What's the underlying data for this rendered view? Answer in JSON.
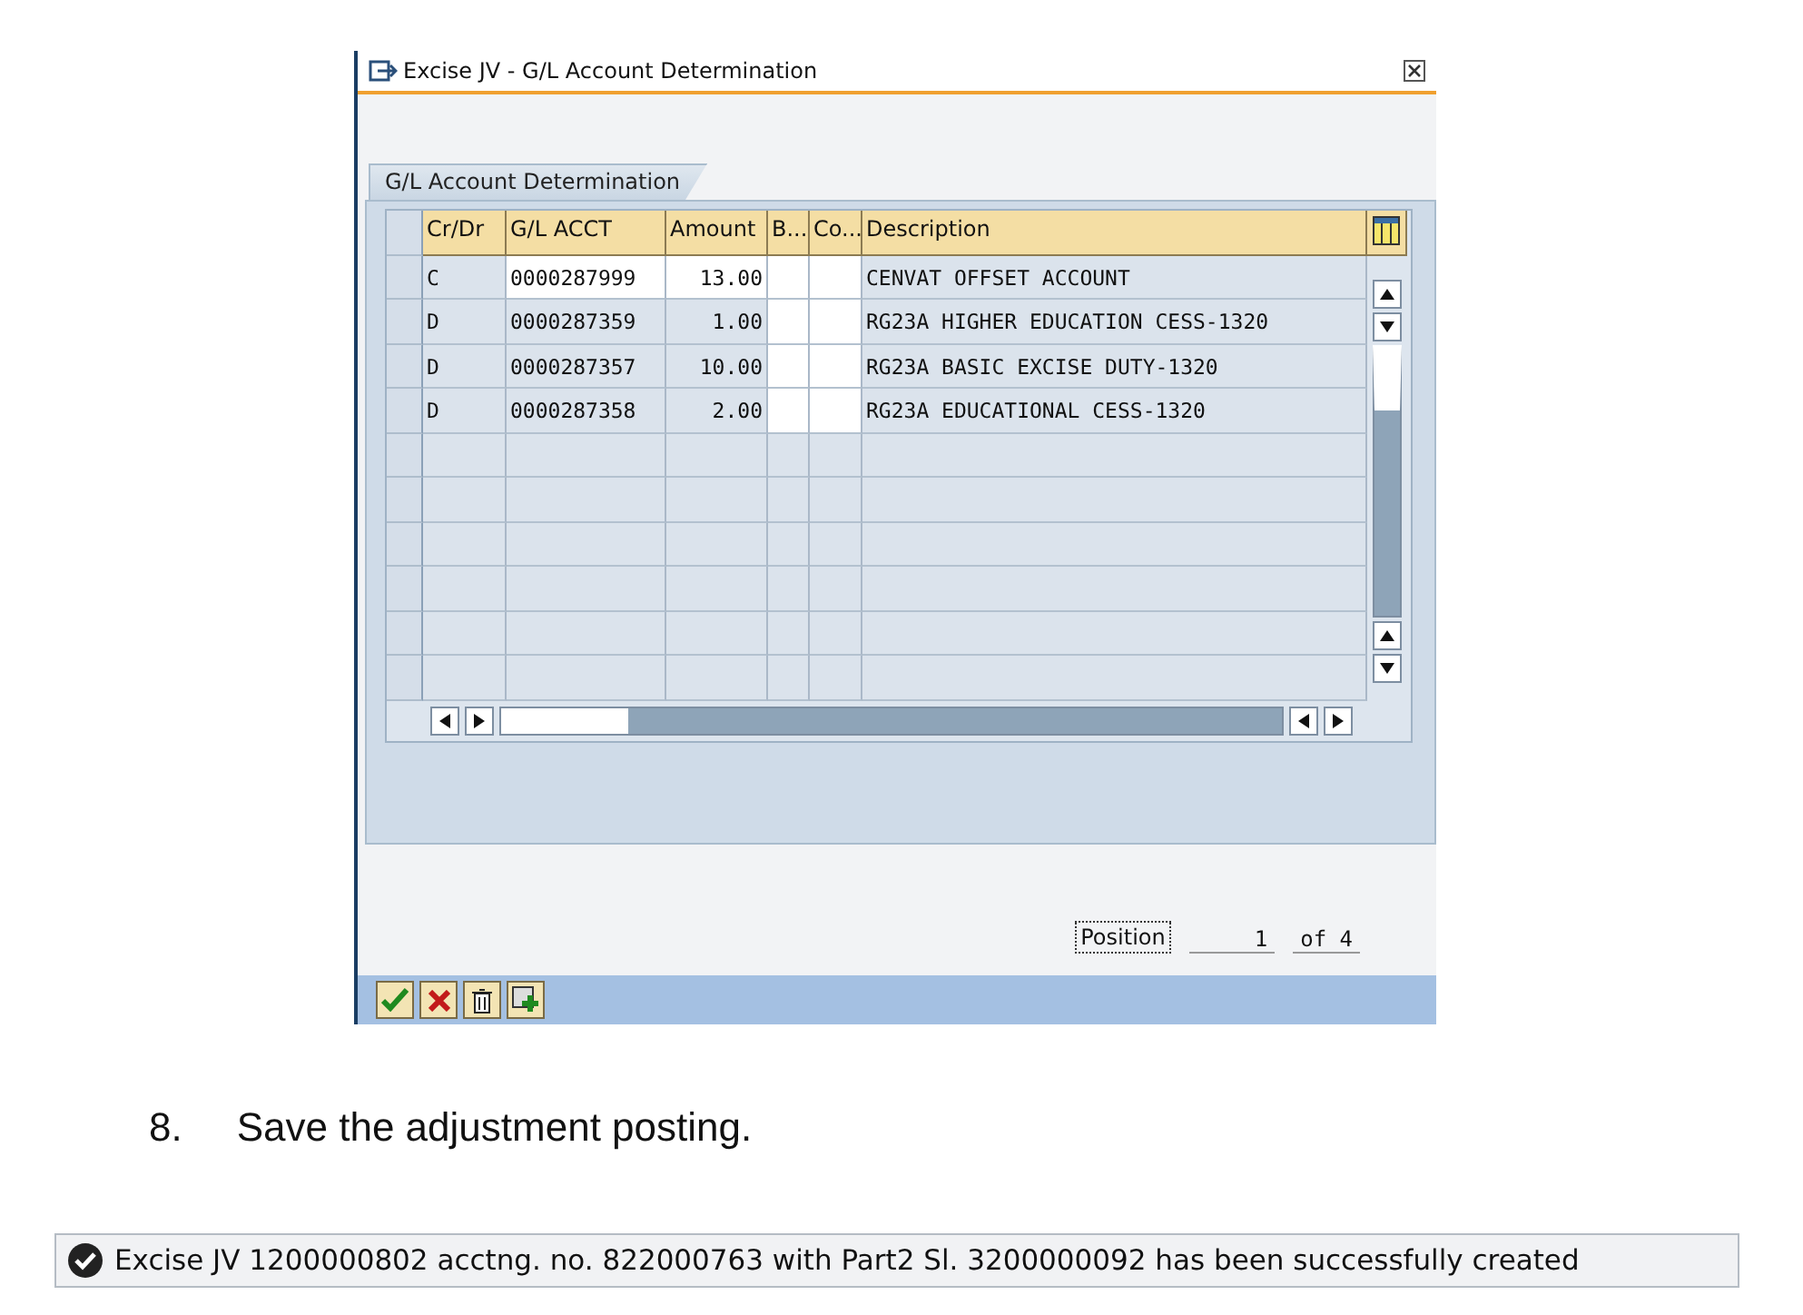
{
  "dialog": {
    "title": "Excise JV - G/L Account Determination",
    "group_title": "G/L Account Determination",
    "table": {
      "columns": [
        "Cr/Dr",
        "G/L ACCT",
        "Amount",
        "B...",
        "Co...",
        "Description"
      ],
      "rows": [
        {
          "cr_dr": "C",
          "gl_acct": "0000287999",
          "amount": "13.00",
          "description": "CENVAT OFFSET ACCOUNT"
        },
        {
          "cr_dr": "D",
          "gl_acct": "0000287359",
          "amount": "1.00",
          "description": "RG23A HIGHER EDUCATION CESS-1320"
        },
        {
          "cr_dr": "D",
          "gl_acct": "0000287357",
          "amount": "10.00",
          "description": "RG23A BASIC EXCISE DUTY-1320"
        },
        {
          "cr_dr": "D",
          "gl_acct": "0000287358",
          "amount": "2.00",
          "description": "RG23A EDUCATIONAL CESS-1320"
        }
      ]
    },
    "position": {
      "button": "Position",
      "value": "1",
      "of": "of 4"
    }
  },
  "step": {
    "number": "8.",
    "text": "Save the adjustment posting."
  },
  "status_message": "Excise JV 1200000802 acctng. no. 822000763 with Part2 Sl. 3200000092 has been successfully created"
}
